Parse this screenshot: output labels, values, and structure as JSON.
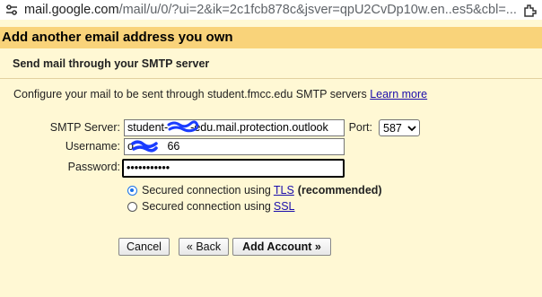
{
  "browser": {
    "url_main": "mail.google.com",
    "url_rest": "/mail/u/0/?ui=2&ik=2c1fcb878c&jsver=qpU2CvDp10w.en..es5&cbl=..."
  },
  "dialog": {
    "title": "Add another email address you own",
    "section_title": "Send mail through your SMTP server",
    "description": "Configure your mail to be sent through student.fmcc.edu SMTP servers",
    "learn_more": "Learn more",
    "smtp_label": "SMTP Server:",
    "smtp_value": "student-  -edu.mail.protection.outlook",
    "port_label": "Port:",
    "port_value": "587",
    "username_label": "Username:",
    "username_value": "o   66",
    "password_label": "Password:",
    "password_value": "•••••••••••",
    "tls_prefix": "Secured connection using ",
    "tls_link": "TLS",
    "tls_suffix": "(recommended)",
    "ssl_prefix": "Secured connection using ",
    "ssl_link": "SSL",
    "cancel_label": "Cancel",
    "back_label": "« Back",
    "add_label": "Add Account »",
    "selected_security": "TLS"
  },
  "colors": {
    "header_bg": "#f9d37a",
    "page_bg": "#fff8d4",
    "link": "#1a0dab",
    "radio_accent": "#1a73e8",
    "redaction": "#1a3cff"
  },
  "icons": {
    "site_info": "tune-icon",
    "extension": "extension-icon"
  }
}
